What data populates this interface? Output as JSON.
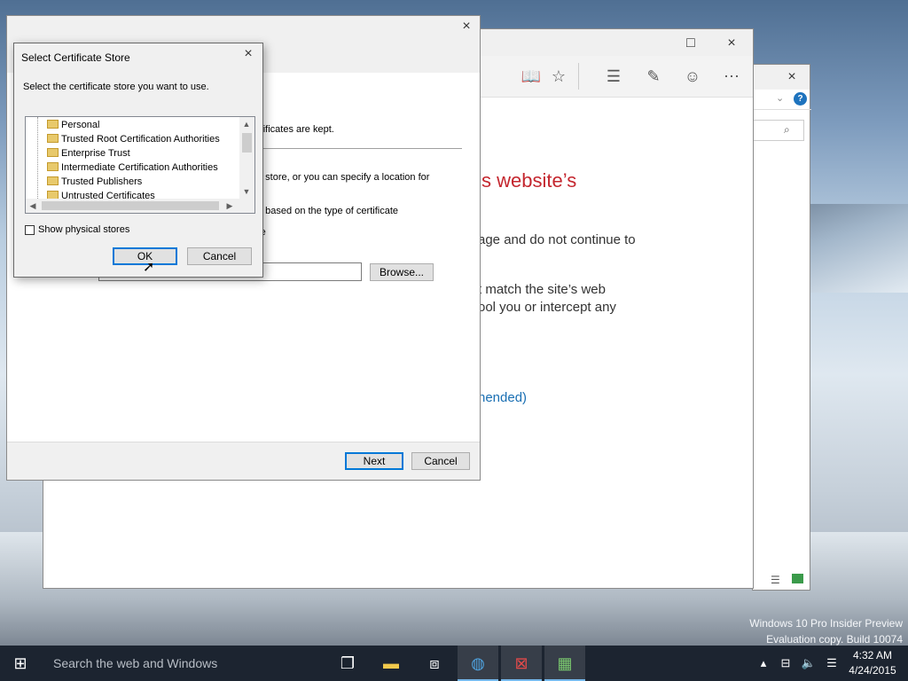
{
  "colors": {
    "accent": "#0078d7",
    "edge_heading": "#c4262e",
    "edge_link": "#1a6fb3",
    "taskbar": "#1c2430"
  },
  "watermark": {
    "line1": "Windows 10 Pro Insider Preview",
    "line2": "Evaluation copy. Build 10074"
  },
  "edge": {
    "close_icon": "×",
    "maximize_icon": "□",
    "heading_fragment": "s website’s",
    "line1": "age and do not continue to",
    "line2": "t match the site’s web",
    "line3": "ool you or intercept any",
    "link_fragment": "nended)",
    "icons": [
      "reading-view-icon",
      "favorites-star-icon",
      "hub-icon",
      "web-note-icon",
      "feedback-smiley-icon",
      "more-icon"
    ]
  },
  "wizard": {
    "text1": "rtificates are kept.",
    "text2": "e store, or you can specify a location for",
    "text3": "e based on the type of certificate",
    "text4": "re",
    "browse_label": "Browse...",
    "next_label": "Next",
    "cancel_label": "Cancel"
  },
  "cert_dialog": {
    "title": "Select Certificate Store",
    "instruction": "Select the certificate store you want to use.",
    "stores": [
      "Personal",
      "Trusted Root Certification Authorities",
      "Enterprise Trust",
      "Intermediate Certification Authorities",
      "Trusted Publishers",
      "Untrusted Certificates"
    ],
    "show_physical_label": "Show physical stores",
    "show_physical_checked": false,
    "ok_label": "OK",
    "cancel_label": "Cancel"
  },
  "taskbar": {
    "search_placeholder": "Search the web and Windows",
    "time": "4:32 AM",
    "date": "4/24/2015"
  }
}
